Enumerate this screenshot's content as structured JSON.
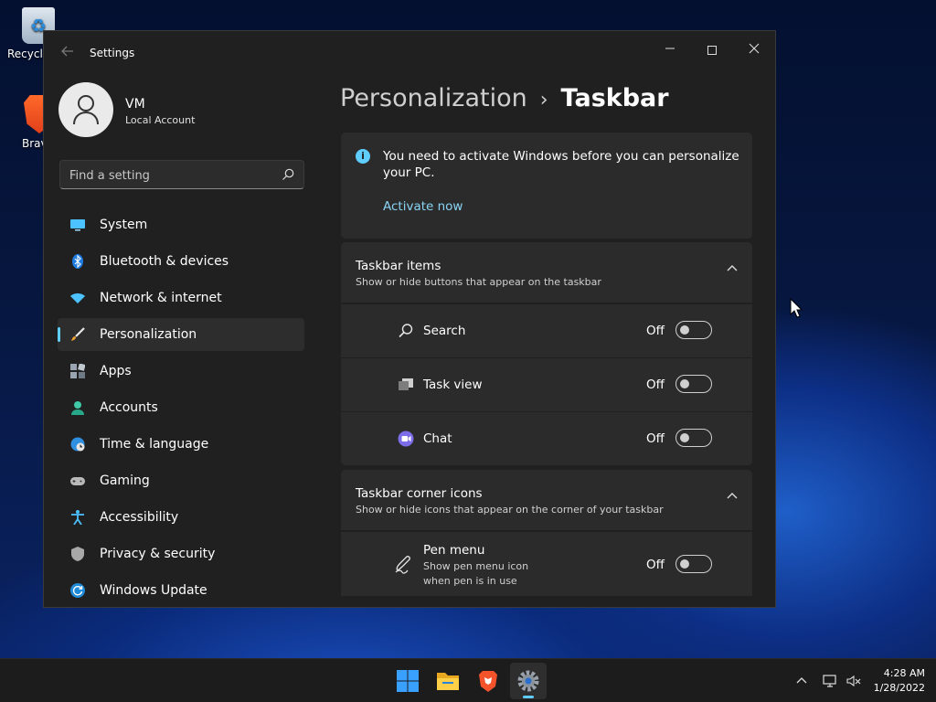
{
  "desktop": {
    "icons": [
      {
        "label": "Recycle"
      },
      {
        "label": "Brav"
      }
    ]
  },
  "window": {
    "title": "Settings",
    "minimize": "—",
    "close": "✕"
  },
  "profile": {
    "name": "VM",
    "account_type": "Local Account"
  },
  "search": {
    "placeholder": "Find a setting"
  },
  "nav": {
    "items": [
      {
        "label": "System"
      },
      {
        "label": "Bluetooth & devices"
      },
      {
        "label": "Network & internet"
      },
      {
        "label": "Personalization"
      },
      {
        "label": "Apps"
      },
      {
        "label": "Accounts"
      },
      {
        "label": "Time & language"
      },
      {
        "label": "Gaming"
      },
      {
        "label": "Accessibility"
      },
      {
        "label": "Privacy & security"
      },
      {
        "label": "Windows Update"
      }
    ],
    "active_index": 3
  },
  "breadcrumb": {
    "parent": "Personalization",
    "separator": "›",
    "current": "Taskbar"
  },
  "activation": {
    "message": "You need to activate Windows before you can personalize your PC.",
    "link": "Activate now"
  },
  "taskbar_items": {
    "title": "Taskbar items",
    "subtitle": "Show or hide buttons that appear on the taskbar",
    "rows": [
      {
        "label": "Search",
        "state": "Off"
      },
      {
        "label": "Task view",
        "state": "Off"
      },
      {
        "label": "Chat",
        "state": "Off"
      }
    ]
  },
  "corner_icons": {
    "title": "Taskbar corner icons",
    "subtitle": "Show or hide icons that appear on the corner of your taskbar",
    "rows": [
      {
        "label": "Pen menu",
        "sub1": "Show pen menu icon",
        "sub2": "when pen is in use",
        "state": "Off"
      }
    ]
  },
  "taskbar": {
    "tray_chevron": "^",
    "time": "4:28 AM",
    "date": "1/28/2022"
  },
  "colors": {
    "accent": "#60cdff",
    "window_bg": "#202020",
    "card_bg": "#2b2b2b"
  }
}
